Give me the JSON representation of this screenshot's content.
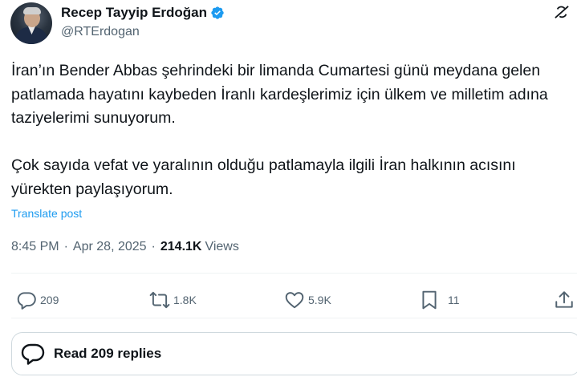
{
  "author": {
    "display_name": "Recep Tayyip Erdoğan",
    "handle": "@RTErdogan",
    "verified": true,
    "verified_color": "#1d9bf0"
  },
  "post": {
    "text": "İran’ın Bender Abbas şehrindeki bir limanda Cumartesi günü meydana gelen patlamada hayatını kaybeden İranlı kardeşlerimiz için ülkem ve milletim adına taziyelerimi sunuyorum.\n\nÇok sayıda vefat ve yaralının olduğu patlamayla ilgili İran halkının acısını yürekten paylaşıyorum.",
    "translate_label": "Translate post",
    "time": "8:45 PM",
    "separator": "·",
    "date": "Apr 28, 2025",
    "views_count": "214.1K",
    "views_label": "Views"
  },
  "actions": {
    "reply_count": "209",
    "repost_count": "1.8K",
    "like_count": "5.9K",
    "bookmark_count": "11"
  },
  "replies_button": {
    "label": "Read 209 replies"
  },
  "colors": {
    "text_primary": "#0f1419",
    "text_secondary": "#536471",
    "link": "#1d9bf0",
    "border": "#cfd9de"
  },
  "icons": [
    "verified-badge-icon",
    "grok-icon",
    "reply-icon",
    "repost-icon",
    "like-icon",
    "bookmark-icon",
    "share-icon",
    "replies-bubble-icon"
  ]
}
